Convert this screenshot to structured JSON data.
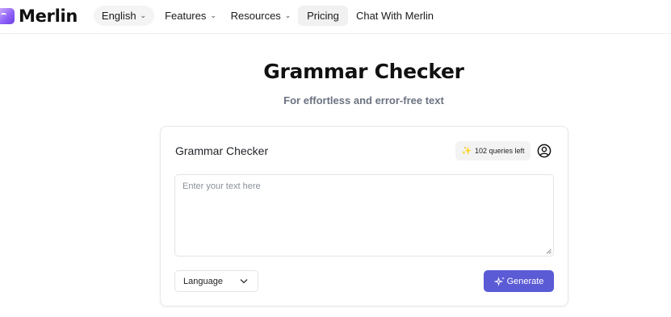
{
  "nav": {
    "brand": "Merlin",
    "language": "English",
    "features": "Features",
    "resources": "Resources",
    "pricing": "Pricing",
    "chat": "Chat With Merlin"
  },
  "hero": {
    "title": "Grammar Checker",
    "subtitle": "For effortless and error-free text"
  },
  "card": {
    "title": "Grammar Checker",
    "queries": "102 queries left",
    "input_placeholder": "Enter your text here",
    "input_value": "",
    "language_select": "Language",
    "generate_label": "Generate"
  },
  "colors": {
    "accent": "#5b5bd6",
    "brand": "#8a5cf6",
    "spark": "#f5a623"
  },
  "icons": {
    "brand": "merlin-logo-icon",
    "nav_chevron": "chevron-down-icon",
    "queries": "sparkle-icon",
    "account": "user-circle-icon",
    "language_chevron": "chevron-down-icon",
    "generate": "sparkle-icon",
    "textarea_resize": "resize-grip-icon"
  }
}
